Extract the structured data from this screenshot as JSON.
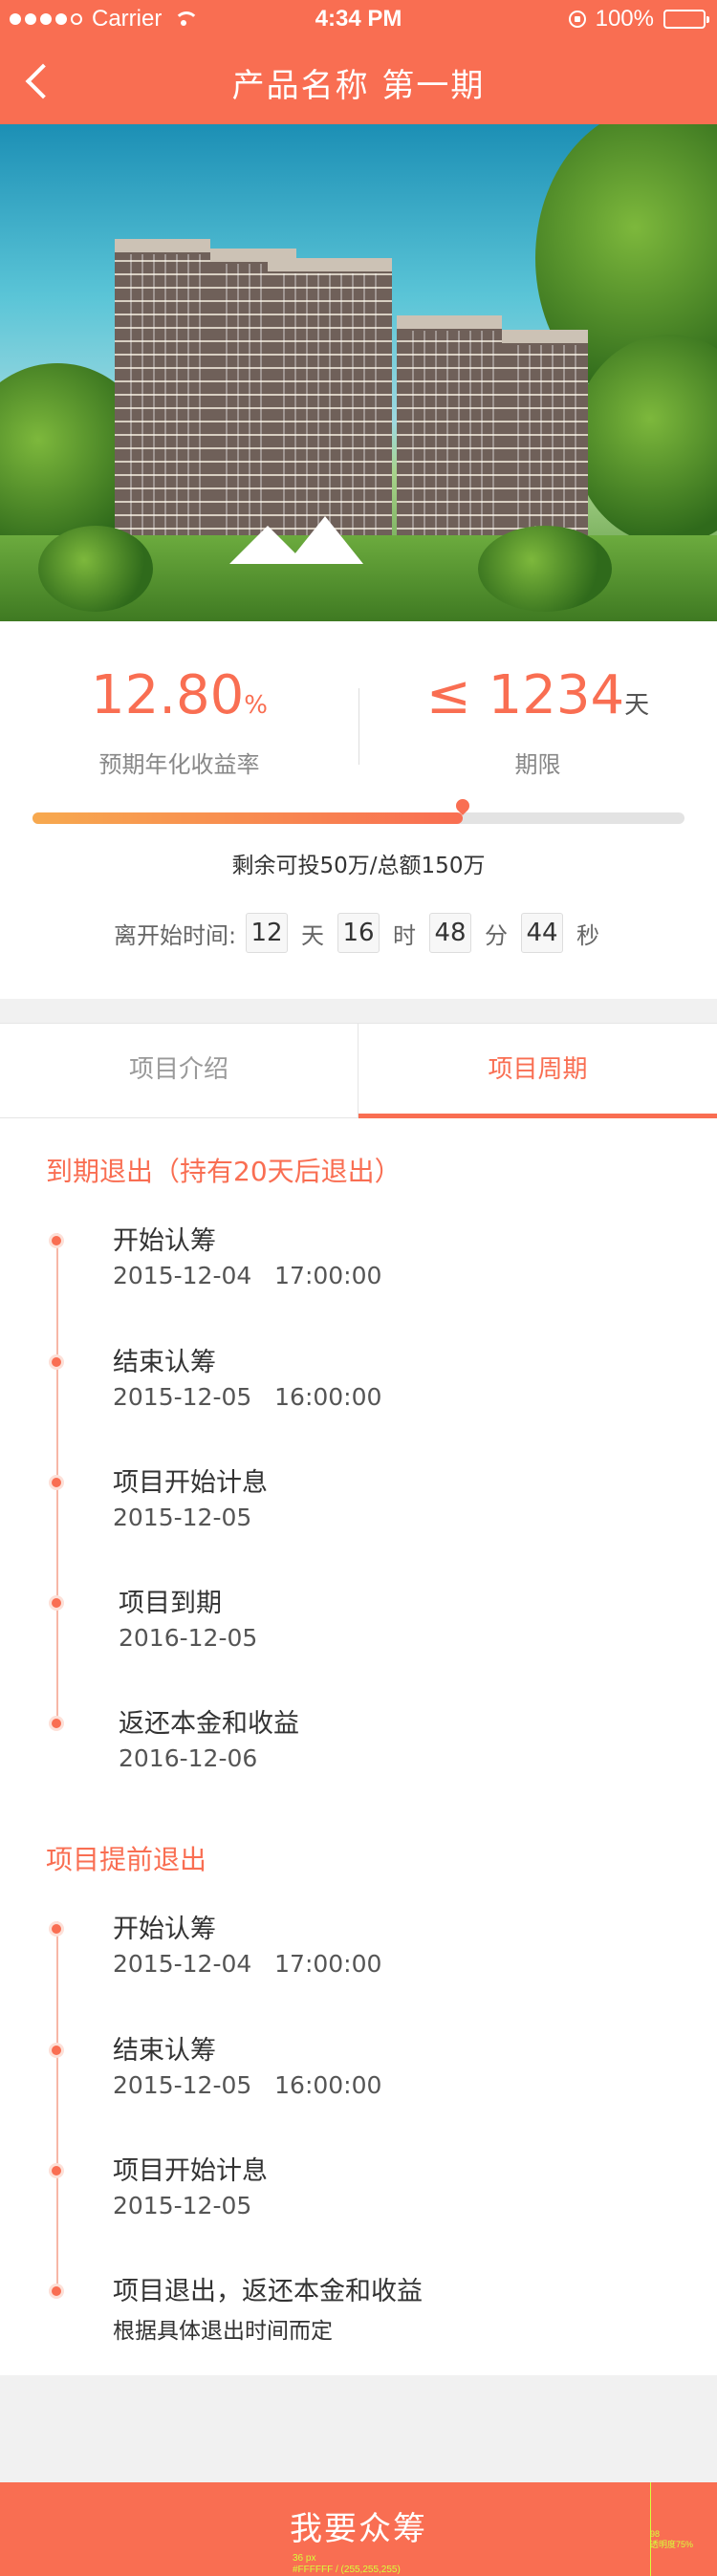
{
  "status_bar": {
    "carrier": "Carrier",
    "time": "4:34 PM",
    "battery": "100%"
  },
  "nav": {
    "title": "产品名称 第一期"
  },
  "hero": {
    "image": "apartment-buildings-photo"
  },
  "metrics": {
    "rate_value": "12.80",
    "rate_unit": "%",
    "rate_label": "预期年化收益率",
    "term_prefix": "≤",
    "term_value": "1234",
    "term_unit": "天",
    "term_label": "期限"
  },
  "progress": {
    "fraction": 0.66,
    "remain_text": "剩余可投50万/总额150万"
  },
  "countdown": {
    "label": "离开始时间:",
    "days": "12",
    "days_unit": "天",
    "hours": "16",
    "hours_unit": "时",
    "minutes": "48",
    "minutes_unit": "分",
    "seconds": "44",
    "seconds_unit": "秒"
  },
  "tabs": [
    {
      "label": "项目介绍"
    },
    {
      "label": "项目周期"
    }
  ],
  "section1": {
    "title": "到期退出（持有20天后退出）",
    "items": [
      {
        "title": "开始认筹",
        "detail": "2015-12-04   17:00:00"
      },
      {
        "title": "结束认筹",
        "detail": "2015-12-05   16:00:00"
      },
      {
        "title": "项目开始计息",
        "detail": "2015-12-05"
      },
      {
        "title": "项目到期",
        "detail": "2016-12-05"
      },
      {
        "title": "返还本金和收益",
        "detail": "2016-12-06"
      }
    ]
  },
  "section2": {
    "title": "项目提前退出",
    "items": [
      {
        "title": "开始认筹",
        "detail": "2015-12-04   17:00:00"
      },
      {
        "title": "结束认筹",
        "detail": "2015-12-05   16:00:00"
      },
      {
        "title": "项目开始计息",
        "detail": "2015-12-05"
      },
      {
        "title": "项目退出，返还本金和收益",
        "detail": "根据具体退出时间而定"
      }
    ]
  },
  "cta": {
    "label": "我要众筹"
  },
  "annotations": {
    "font_note_1": "36 px",
    "font_note_2": "#FFFFFF / (255,255,255)",
    "side_note_1": "98",
    "side_note_2": "透明度75%"
  },
  "colors": {
    "accent": "#f96e52",
    "background": "#f1f1f1"
  }
}
